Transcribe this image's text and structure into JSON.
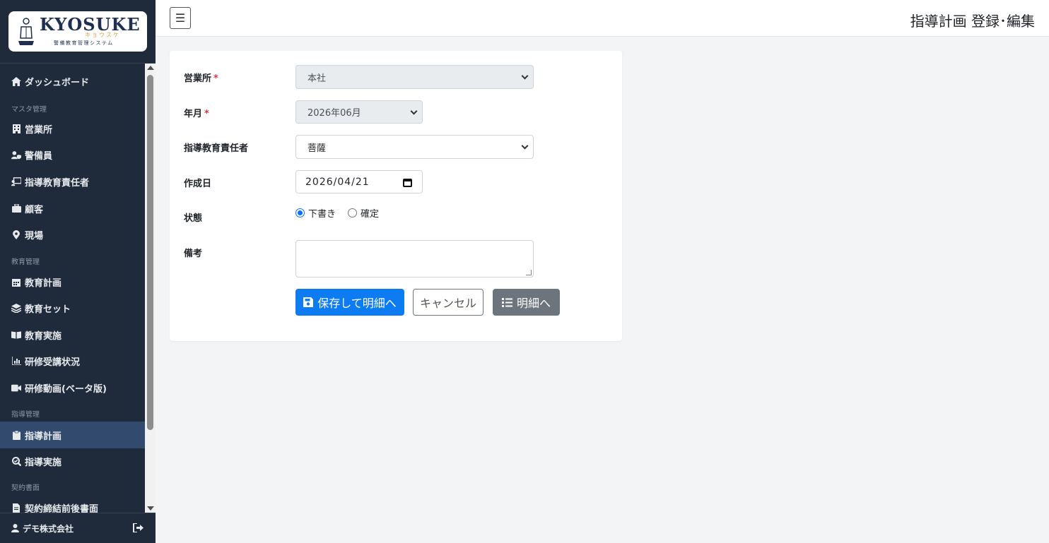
{
  "brand": {
    "title": "KYOSUKE",
    "kana": "キョウスケ",
    "subtitle": "警備教育管理システム"
  },
  "header": {
    "page_title": "指導計画 登録･編集",
    "toggle_icon": "hamburger-icon"
  },
  "sidebar": {
    "dashboard": "ダッシュボード",
    "section_master": "マスタ管理",
    "office": "営業所",
    "guard": "警備員",
    "instructor": "指導教育責任者",
    "customer": "顧客",
    "site": "現場",
    "section_education": "教育管理",
    "education_plan": "教育計画",
    "education_set": "教育セット",
    "education_exec": "教育実施",
    "training_status": "研修受講状況",
    "training_video": "研修動画(ベータ版)",
    "section_guidance": "指導管理",
    "guidance_plan": "指導計画",
    "guidance_exec": "指導実施",
    "section_contract": "契約書面",
    "contract_docs": "契約締結前後書面",
    "user": "デモ株式会社"
  },
  "form": {
    "office_label": "営業所",
    "office_value": "本社",
    "month_label": "年月",
    "month_value": "2026年06月",
    "instructor_label": "指導教育責任者",
    "instructor_value": "菩薩",
    "created_label": "作成日",
    "created_value": "2026/04/21",
    "status_label": "状態",
    "status_options": [
      "下書き",
      "確定"
    ],
    "status_selected": "下書き",
    "notes_label": "備考",
    "notes_value": "",
    "required_mark": "*"
  },
  "buttons": {
    "save": "保存して明細へ",
    "cancel": "キャンセル",
    "detail": "明細へ"
  },
  "colors": {
    "sidebar_bg": "#1f2b3a",
    "active_bg": "#314a6d",
    "primary": "#0d7cf2",
    "secondary": "#6c757d",
    "required": "#dc3545"
  }
}
